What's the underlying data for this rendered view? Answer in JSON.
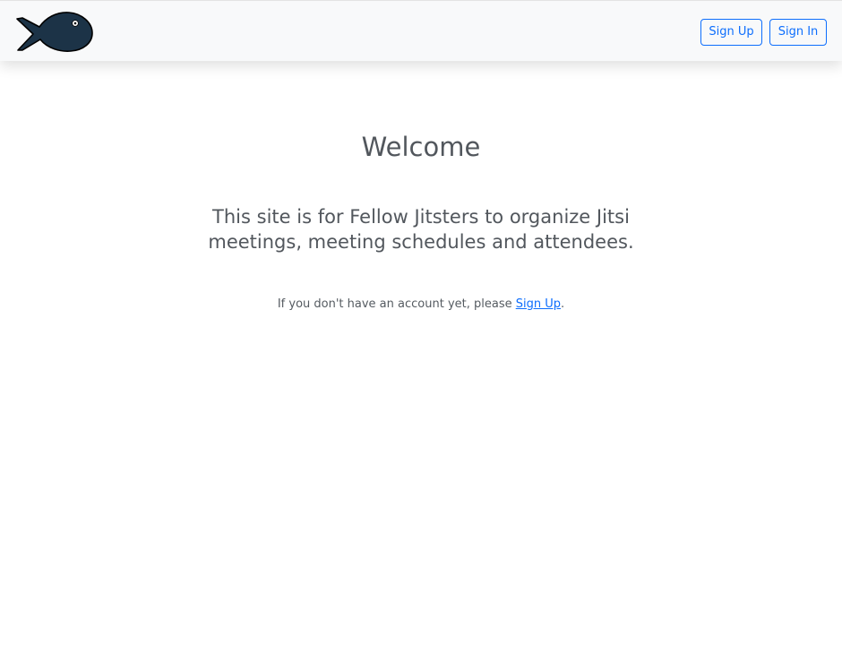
{
  "header": {
    "logo_icon": "fish-icon",
    "sign_up_label": "Sign Up",
    "sign_in_label": "Sign In"
  },
  "main": {
    "title": "Welcome",
    "description": "This site is for Fellow Jitsters to organize Jitsi meetings, meeting schedules and attendees.",
    "signup_prompt": {
      "prefix": "If you don't have an account yet, please ",
      "link_label": "Sign Up",
      "suffix": "."
    }
  },
  "colors": {
    "accent": "#0d6efd",
    "text": "#52575d",
    "topbar_bg": "#f8f9fa",
    "fish_body": "#1c3347"
  }
}
